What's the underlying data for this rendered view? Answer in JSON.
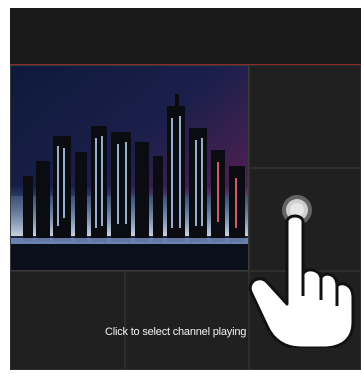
{
  "screen": {
    "hint_text": "Click to select channel playing"
  },
  "grid": {
    "active_channel_icon": "city-skyline-video",
    "empty_channel_icon": "blank-tile"
  },
  "cursor": {
    "icon": "pointing-hand-icon",
    "target": "tap-target-ring-icon"
  },
  "colors": {
    "panel": "#1c1c1c",
    "topbar_accent": "#8a2a2a",
    "text": "#f2f2f2"
  }
}
